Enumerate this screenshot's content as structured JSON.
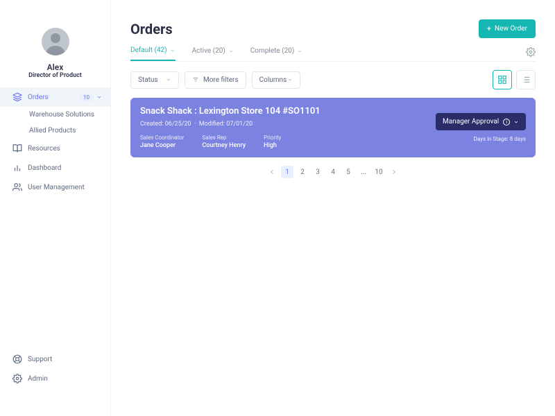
{
  "user": {
    "name": "Alex",
    "role": "Director of Product"
  },
  "sidebar": {
    "orders": {
      "label": "Orders",
      "badge": "10"
    },
    "orders_children": [
      "Warehouse Solutions",
      "Allied Products"
    ],
    "resources": "Resources",
    "dashboard": "Dashboard",
    "user_mgmt": "User Management",
    "support": "Support",
    "admin": "Admin"
  },
  "header": {
    "title": "Orders",
    "new_order": "New Order"
  },
  "tabs": [
    {
      "label": "Default (42)",
      "active": true
    },
    {
      "label": "Active (20)",
      "active": false
    },
    {
      "label": "Complete (20)",
      "active": false
    }
  ],
  "filters": {
    "status": "Status",
    "more": "More filters",
    "columns": "Columns"
  },
  "card": {
    "title": "Snack Shack : Lexington Store 104 #SO1101",
    "created_lbl": "Created:",
    "created_val": "06/25/20",
    "modified_lbl": "Modified:",
    "modified_val": "07/01/20",
    "cols": [
      {
        "label": "Sales Coordinator",
        "value": "Jane Cooper"
      },
      {
        "label": "Sales Rep",
        "value": "Courtney Henry"
      },
      {
        "label": "Priority",
        "value": "High"
      }
    ],
    "approval": "Manager Approval",
    "days_label": "Days in Stage:",
    "days_value": "8 days"
  },
  "pagination": {
    "pages": [
      "1",
      "2",
      "3",
      "4",
      "5",
      "...",
      "10"
    ],
    "current": "1"
  }
}
